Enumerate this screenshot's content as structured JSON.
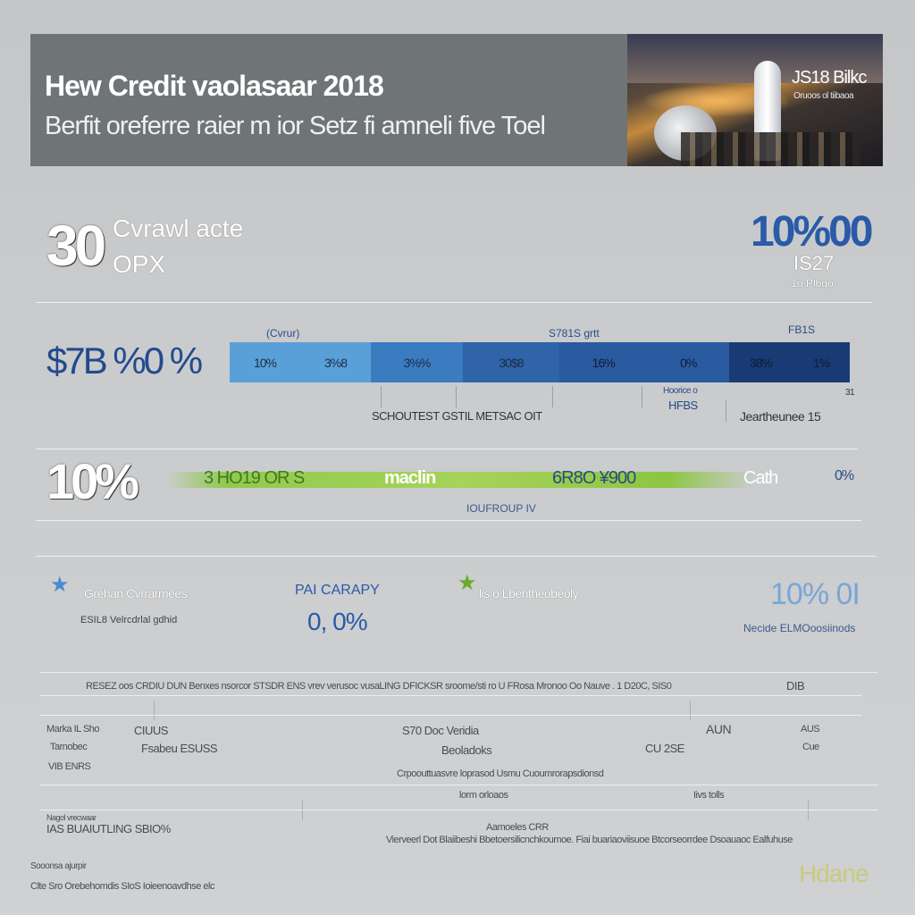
{
  "header": {
    "title": "Hew Credit  vaolasaar 2018",
    "subtitle": "Berfit oreferre raier m ior Setz fi  amneli five Toel",
    "photo_text": "JS18 Bilkc",
    "photo_subtext": "Oruoos ol tiibaoa"
  },
  "stats": {
    "big_value": "30",
    "label_line1": "Cvrawl acte",
    "label_line2": "OPX",
    "right_value": "10%00",
    "right_sub": "IS27",
    "right_small": "- 1o Plbgo"
  },
  "segment_row": {
    "lead": "$7B %0 %",
    "headers": [
      "(Cvrur)",
      "S781S grtt",
      "FB1S"
    ],
    "segments": [
      {
        "labels": [
          "10%",
          "3%8"
        ],
        "color": "#5aa0d8",
        "share": 0.228
      },
      {
        "labels": [
          "3%%"
        ],
        "color": "#3b7bc0",
        "share": 0.148
      },
      {
        "labels": [
          "30$8"
        ],
        "color": "#2f64a8",
        "share": 0.156
      },
      {
        "labels": [
          "16%",
          "0%"
        ],
        "color": "#2a5aa0",
        "share": 0.274
      },
      {
        "labels": [
          "38%",
          "1%"
        ],
        "color": "#1a3a75",
        "share": 0.194
      }
    ],
    "note_left": "SCHOUTEST GSTIL METSAC OIT",
    "note_mid_top": "Hoorice o",
    "note_mid": "HFBS",
    "note_right": "Jeartheunee  15",
    "note_far_right": "31"
  },
  "green_row": {
    "big_pct": "10%",
    "items": [
      "3 HO19 OR S",
      "maclin",
      "6R8O  ¥900",
      "Cath",
      "0%"
    ],
    "caption": "IOUFROUP IV"
  },
  "legend_row": {
    "item1": "Grehan Cvrrarmees",
    "item1_sub": "ESIL8 Velrcdrlal gdhid",
    "item2_title": "PAI CARAPY",
    "item2_val": "0, 0%",
    "item3": "lis o Lbentheobeoly",
    "item4_val": "10% 0I",
    "item4_sub": "Necide ELMOoosiinods"
  },
  "table": {
    "header": "RESEZ oos CRDIU DUN Benxes nsorcor STSDR ENS vrev verusoc vusaLING DFICKSR sroome/sti ro U FRosa Mronoo Oo Nauve . 1 D20C, SIS0",
    "header_right": "DIB",
    "row1_left": "Marka IL Sho",
    "row1_mid": "CIUUS",
    "row1_center": "S70  Doc Veridia",
    "row1_right": "AUN",
    "row1_far": "AUS",
    "row2_left": "Tarnobec",
    "row2_mid": "Fsabeu ESUSS",
    "row2_center": "Beoladoks",
    "row2_right": "CU 2SE",
    "row2_far": "Cue",
    "row3_left": "VIB ENRS",
    "row3_center": "Crpoouttuasvre loprasod Usmu Cuoumrorapsdionsd",
    "row4_center": "lorm orloaos",
    "row4_right": "Iivs tolls",
    "sub_label": "Nagol vrecwaar",
    "total_left": "IAS BUAIUTLING  SBIO%",
    "total_center": "Aamoeles CRR",
    "total_right": "Vierveerl Dot Blaiibeshi Bbetoersilicnchkoumoe. Fiai buariaoviisuoe Btcorseorrdee Dsoauaoc Ealfuhuse",
    "footer_line1": "Sooonsa ajurpir",
    "footer_line2": "Clte Sro Orebehomdis SIoS Ioieenoavdhse elc",
    "footer_logo": "Hdane"
  },
  "colors": {
    "banner": "#6f7477",
    "accent_blue": "#2a5aa8",
    "accent_green": "#92c94e",
    "background": "#c9cbcd"
  }
}
